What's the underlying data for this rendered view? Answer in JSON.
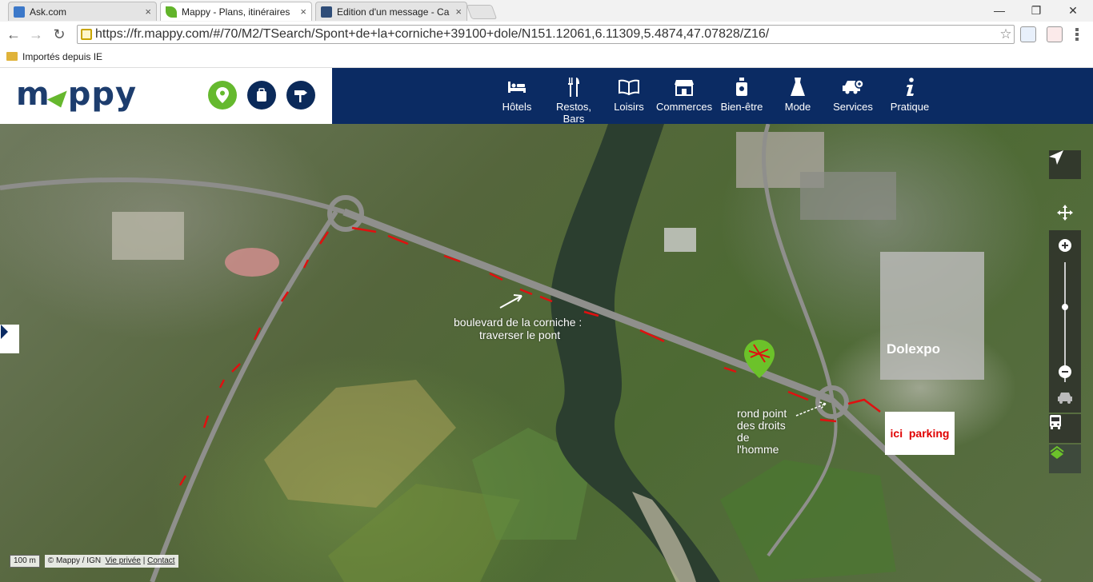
{
  "browser": {
    "tabs": [
      {
        "title": "Ask.com",
        "active": false,
        "color": "#3b78c9"
      },
      {
        "title": "Mappy - Plans, itinéraires",
        "active": true,
        "color": "#62b42a"
      },
      {
        "title": "Edition d'un message - Ca",
        "active": false,
        "color": "#2f4d78"
      }
    ],
    "close_glyph": "×",
    "window": {
      "minimize": "—",
      "maximize": "❐",
      "close": "✕"
    },
    "nav": {
      "back": "←",
      "forward": "→",
      "reload": "↻"
    },
    "url": "https://fr.mappy.com/#/70/M2/TSearch/Spont+de+la+corniche+39100+dole/N151.12061,6.11309,5.4874,47.07828/Z16/",
    "star": "☆",
    "bookmark_folder": "Importés depuis IE"
  },
  "mappy": {
    "logo_left": "m",
    "logo_right": "ppy",
    "brand_colors": {
      "navy": "#0b2b63",
      "green": "#65b92e"
    },
    "header_buttons": [
      "location-pin-icon",
      "briefcase-icon",
      "signpost-icon"
    ],
    "nav": [
      {
        "label": "Hôtels",
        "icon": "bed-icon"
      },
      {
        "label": "Restos, Bars",
        "icon": "cutlery-icon"
      },
      {
        "label": "Loisirs",
        "icon": "book-icon"
      },
      {
        "label": "Commerces",
        "icon": "shop-icon"
      },
      {
        "label": "Bien-être",
        "icon": "spa-bottle-icon"
      },
      {
        "label": "Mode",
        "icon": "dress-icon"
      },
      {
        "label": "Services",
        "icon": "car-service-icon"
      },
      {
        "label": "Pratique",
        "icon": "info-icon"
      }
    ]
  },
  "map": {
    "annotations": {
      "boulevard_line1": "boulevard de la corniche :",
      "boulevard_line2": "traverser le pont",
      "rond_line1": "rond point",
      "rond_line2": "des droits",
      "rond_line3": "de",
      "rond_line4": "l'homme",
      "dolexpo": "Dolexpo",
      "parking": "ici  parking"
    },
    "controls": [
      "locate-arrow-icon",
      "pan-icon",
      "zoom-in-icon",
      "zoom-out-icon",
      "traffic-car-icon",
      "bus-icon",
      "satellite-layer-icon"
    ],
    "scale": "100 m",
    "copyright": "© Mappy / IGN",
    "privacy": "Vie privée",
    "separator": "|",
    "contact": "Contact"
  }
}
